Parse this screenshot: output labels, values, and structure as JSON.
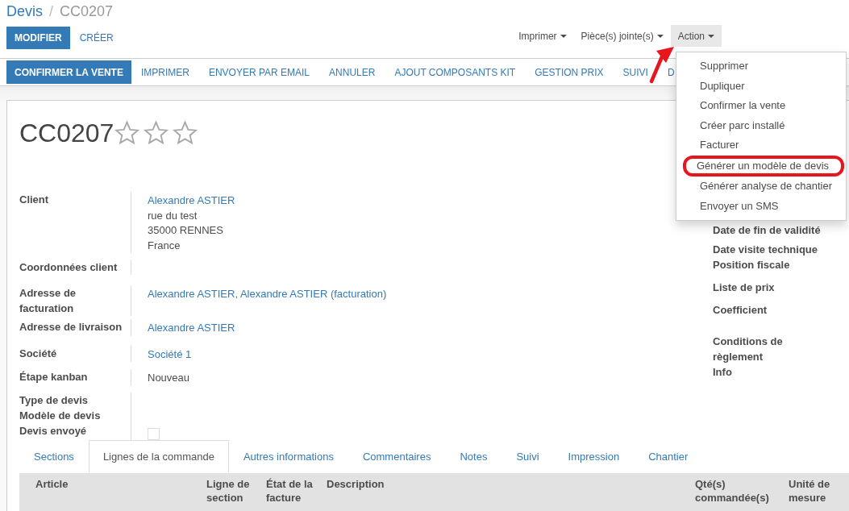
{
  "breadcrumb": {
    "parent": "Devis",
    "separator": "/",
    "current": "CC0207"
  },
  "buttons": [
    {
      "label": "MODIFIER",
      "primary": true
    },
    {
      "label": "CRÉER",
      "primary": false
    }
  ],
  "menus": [
    {
      "label": "Imprimer",
      "open": false
    },
    {
      "label": "Pièce(s) jointe(s)",
      "open": false
    },
    {
      "label": "Action",
      "open": true
    }
  ],
  "action_menu": [
    {
      "label": "Supprimer",
      "highlighted": false
    },
    {
      "label": "Dupliquer",
      "highlighted": false
    },
    {
      "label": "Confirmer la vente",
      "highlighted": false
    },
    {
      "label": "Créer parc installé",
      "highlighted": false
    },
    {
      "label": "Facturer",
      "highlighted": false
    },
    {
      "label": "Générer un modèle de devis",
      "highlighted": true
    },
    {
      "label": "Générer analyse de chantier",
      "highlighted": false
    },
    {
      "label": "Envoyer un SMS",
      "highlighted": false
    }
  ],
  "status_buttons": [
    {
      "label": "CONFIRMER LA VENTE",
      "primary": true
    },
    {
      "label": "IMPRIMER",
      "primary": false
    },
    {
      "label": "ENVOYER PAR EMAIL",
      "primary": false
    },
    {
      "label": "ANNULER",
      "primary": false
    },
    {
      "label": "AJOUT COMPOSANTS KIT",
      "primary": false
    },
    {
      "label": "GESTION PRIX",
      "primary": false
    },
    {
      "label": "SUIVI",
      "primary": false
    },
    {
      "label": "D",
      "primary": false
    }
  ],
  "record": {
    "title": "CC0207",
    "stars": 0
  },
  "fields_left": [
    {
      "label": "Client",
      "kind": "text",
      "values": [
        {
          "text": "Alexandre ASTIER",
          "link": true
        },
        {
          "text": "rue du test",
          "link": false
        },
        {
          "text": "35000 RENNES",
          "link": false
        },
        {
          "text": "France",
          "link": false
        }
      ]
    },
    {
      "label": "Coordonnées client",
      "kind": "text"
    },
    {
      "label": "Adresse de facturation",
      "kind": "text",
      "values": [
        {
          "text": "Alexandre ASTIER, Alexandre ASTIER (facturation)",
          "link": true
        }
      ]
    },
    {
      "label": "Adresse de livraison",
      "kind": "text",
      "values": [
        {
          "text": "Alexandre ASTIER",
          "link": true
        }
      ]
    },
    {
      "label": "Société",
      "kind": "text",
      "values": [
        {
          "text": "Société 1",
          "link": true
        }
      ]
    },
    {
      "label": "Étape kanban",
      "kind": "text",
      "values": [
        {
          "text": "Nouveau",
          "link": false
        }
      ]
    },
    {
      "label": "Type de devis",
      "kind": "text"
    },
    {
      "label": "Modèle de devis",
      "kind": "text"
    },
    {
      "label": "Devis envoyé",
      "kind": "checkbox",
      "checked": false
    }
  ],
  "fields_right": [
    "Date de fin de validité",
    "Date visite technique",
    "Position fiscale",
    "Liste de prix",
    "Coefficient",
    "Conditions de règlement",
    "Info"
  ],
  "tabs": [
    {
      "label": "Sections",
      "selected": false
    },
    {
      "label": "Lignes de la commande",
      "selected": true
    },
    {
      "label": "Autres informations",
      "selected": false
    },
    {
      "label": "Commentaires",
      "selected": false
    },
    {
      "label": "Notes",
      "selected": false
    },
    {
      "label": "Suivi",
      "selected": false
    },
    {
      "label": "Impression",
      "selected": false
    },
    {
      "label": "Chantier",
      "selected": false
    }
  ],
  "table": {
    "columns": [
      "Article",
      "Ligne de section",
      "État de la facture",
      "Description",
      "Qté(s) commandée(s)",
      "Unité de mesure"
    ]
  }
}
